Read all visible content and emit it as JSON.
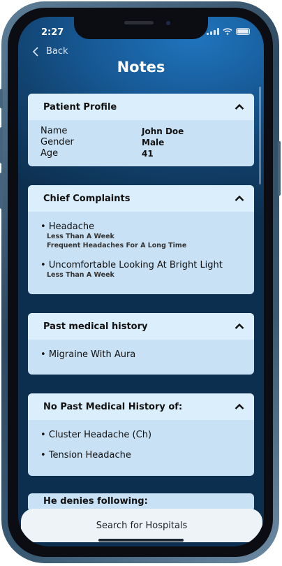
{
  "status": {
    "time": "2:27"
  },
  "nav": {
    "back_label": "Back",
    "title": "Notes"
  },
  "patient_profile": {
    "title": "Patient Profile",
    "rows": [
      {
        "label": "Name",
        "value": "John Doe"
      },
      {
        "label": "Gender",
        "value": "Male"
      },
      {
        "label": "Age",
        "value": "41"
      }
    ]
  },
  "chief_complaints": {
    "title": "Chief Complaints",
    "items": [
      {
        "name": "Headache",
        "details": [
          "Less Than A Week",
          "Frequent Headaches For A Long Time"
        ]
      },
      {
        "name": "Uncomfortable Looking At Bright Light",
        "details": [
          "Less Than A Week"
        ]
      }
    ]
  },
  "past_medical_history": {
    "title": "Past medical history",
    "items": [
      "Migraine With Aura"
    ]
  },
  "no_past_history": {
    "title": "No Past Medical History of:",
    "items": [
      "Cluster Headache (Ch)",
      "Tension Headache"
    ]
  },
  "next_section": {
    "title": "He denies following:"
  },
  "footer": {
    "search_label": "Search for Hospitals"
  },
  "colors": {
    "card_bg": "#c8e1f5",
    "header_bg": "#dbeefb",
    "screen_bg": "#175a97"
  },
  "icons": {
    "collapse": "chevron-up-icon",
    "back": "chevron-left-icon"
  }
}
